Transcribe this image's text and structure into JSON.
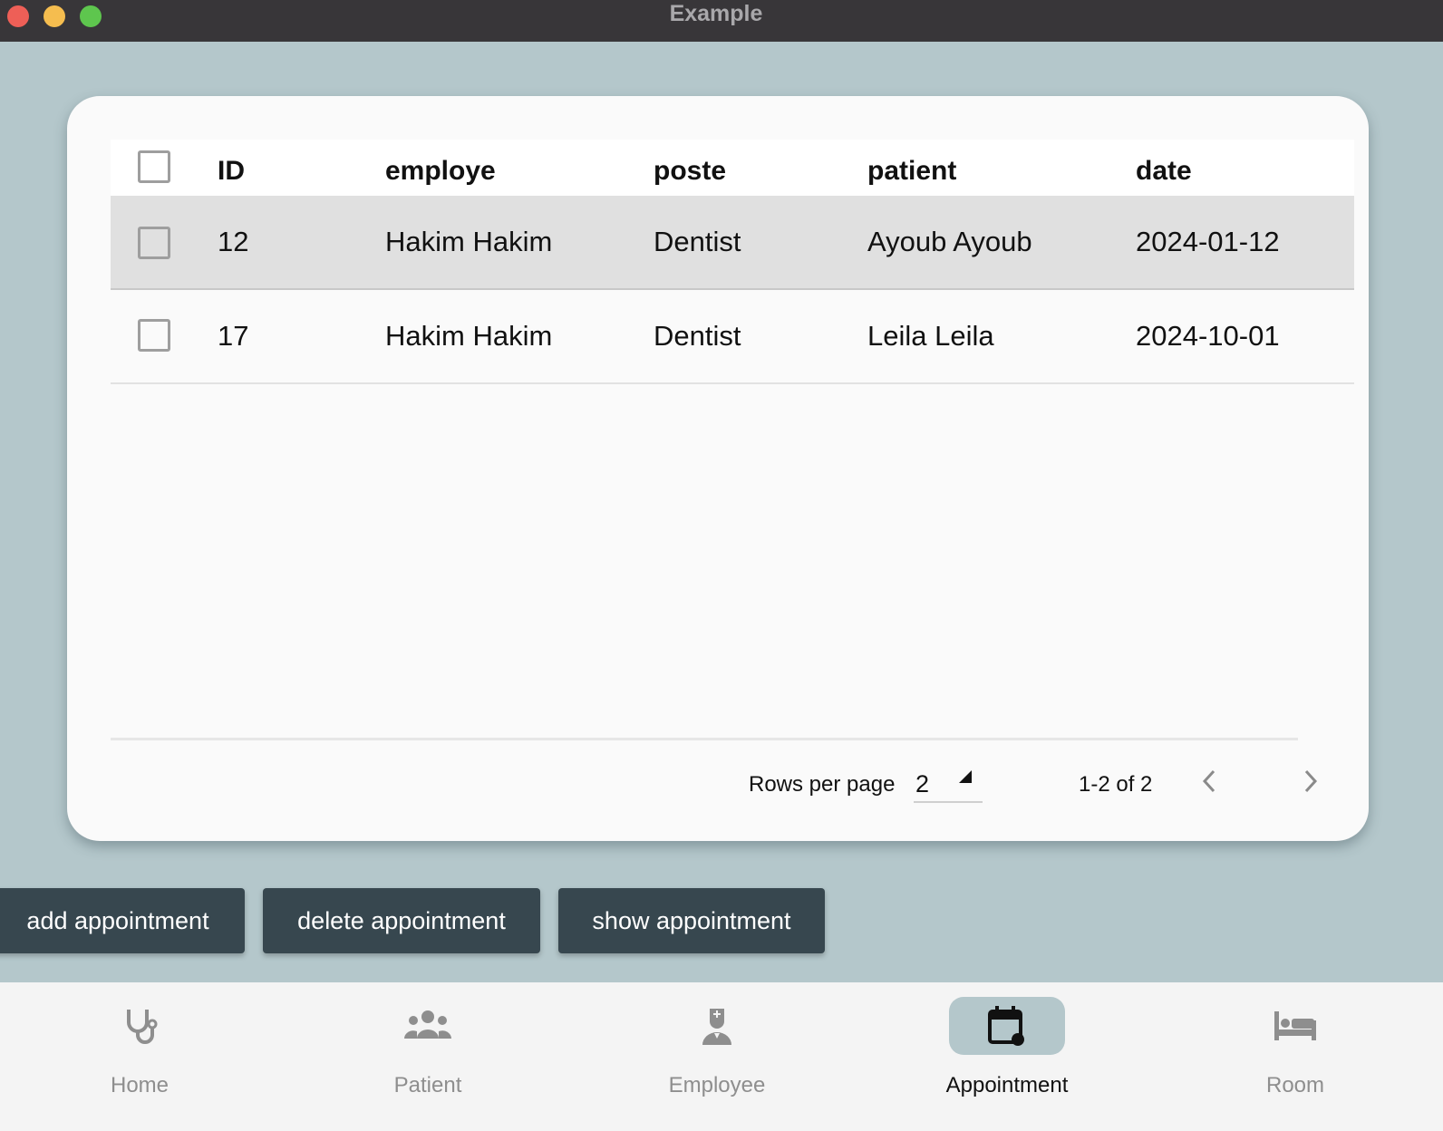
{
  "window": {
    "title": "Example"
  },
  "table": {
    "columns": [
      "ID",
      "employe",
      "poste",
      "patient",
      "date"
    ],
    "rows": [
      {
        "id": "12",
        "employe": "Hakim Hakim",
        "poste": "Dentist",
        "patient": "Ayoub Ayoub",
        "date": "2024-01-12",
        "selected": true
      },
      {
        "id": "17",
        "employe": "Hakim Hakim",
        "poste": "Dentist",
        "patient": "Leila Leila",
        "date": "2024-10-01",
        "selected": false
      }
    ]
  },
  "pagination": {
    "rows_per_page_label": "Rows per page",
    "rows_per_page_value": "2",
    "range_label": "1-2 of 2"
  },
  "actions": {
    "add_label": "add appointment",
    "delete_label": "delete appointment",
    "show_label": "show appointment"
  },
  "nav": {
    "items": [
      {
        "label": "Home",
        "icon": "stethoscope-icon"
      },
      {
        "label": "Patient",
        "icon": "group-icon"
      },
      {
        "label": "Employee",
        "icon": "doctor-icon"
      },
      {
        "label": "Appointment",
        "icon": "calendar-icon",
        "active": true
      },
      {
        "label": "Room",
        "icon": "bed-icon"
      }
    ]
  },
  "colors": {
    "background": "#b4c7cb",
    "titlebar": "#383639",
    "button": "#37474f",
    "selected_row": "#e0e0e0",
    "nav_active_pill": "#b4c7cb"
  }
}
